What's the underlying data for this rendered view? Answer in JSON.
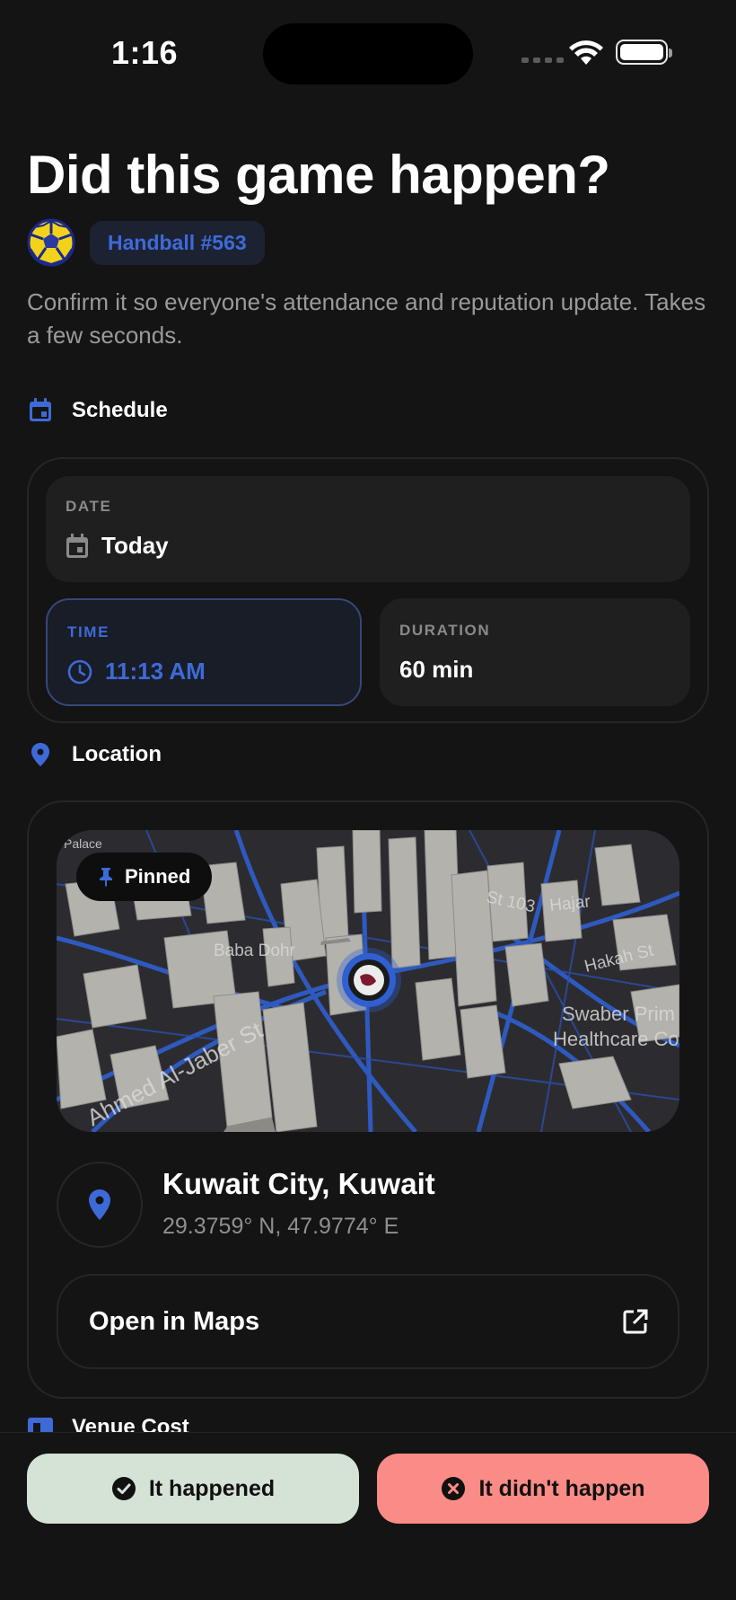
{
  "status_bar": {
    "time": "1:16"
  },
  "header": {
    "title": "Did this game happen?",
    "sport_badge": "Handball #563",
    "subtitle": "Confirm it so everyone's attendance and reputation update. Takes a few seconds."
  },
  "schedule": {
    "section_title": "Schedule",
    "date_label": "DATE",
    "date_value": "Today",
    "time_label": "TIME",
    "time_value": "11:13 AM",
    "duration_label": "DURATION",
    "duration_value": "60 min"
  },
  "location": {
    "section_title": "Location",
    "pinned_label": "Pinned",
    "map_labels": [
      "Palace",
      "St 103",
      "Hajar",
      "Baba Dohr",
      "Hakah St",
      "Swaber Prim",
      "Healthcare Co",
      "Ahmed Al-Jaber St"
    ],
    "place_name": "Kuwait City, Kuwait",
    "coordinates": "29.3759° N, 47.9774° E",
    "open_maps_label": "Open in Maps"
  },
  "venue_cost": {
    "section_title": "Venue Cost"
  },
  "actions": {
    "happened_label": "It happened",
    "not_happened_label": "It didn't happen"
  },
  "colors": {
    "accent_blue": "#3e6ad8",
    "confirm_bg": "#d5e2d6",
    "reject_bg": "#fb8b86",
    "background": "#141414"
  },
  "icons": [
    "wifi-icon",
    "battery-icon",
    "handball-icon",
    "calendar-icon",
    "clock-icon",
    "location-pin-icon",
    "pin-icon",
    "external-link-icon",
    "check-circle-icon",
    "x-circle-icon",
    "ticket-icon"
  ]
}
